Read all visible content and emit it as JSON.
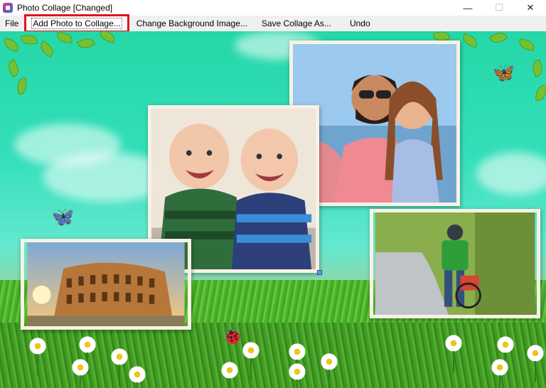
{
  "window": {
    "title": "Photo Collage [Changed]",
    "controls": {
      "minimize": "—",
      "maximize": "☐",
      "close": "✕"
    }
  },
  "menu": {
    "file": "File",
    "add_photo": "Add Photo to Collage...",
    "change_background": "Change Background Image...",
    "save_as": "Save Collage As...",
    "undo": "Undo"
  },
  "canvas": {
    "photos": [
      {
        "id": "babies",
        "subject": "two smiling babies"
      },
      {
        "id": "couple",
        "subject": "couple selfie"
      },
      {
        "id": "colosseum",
        "subject": "colosseum at sunset"
      },
      {
        "id": "child-bike",
        "subject": "child with bicycle"
      }
    ],
    "decorations": [
      "butterfly-icon",
      "ladybug-icon",
      "daisy-icon"
    ]
  },
  "colors": {
    "accent": "#e0141e",
    "menubar": "#f0f0f0",
    "sky": "#33dfb9",
    "grass": "#4fb82e",
    "photo_border": "#f7f2e4"
  }
}
